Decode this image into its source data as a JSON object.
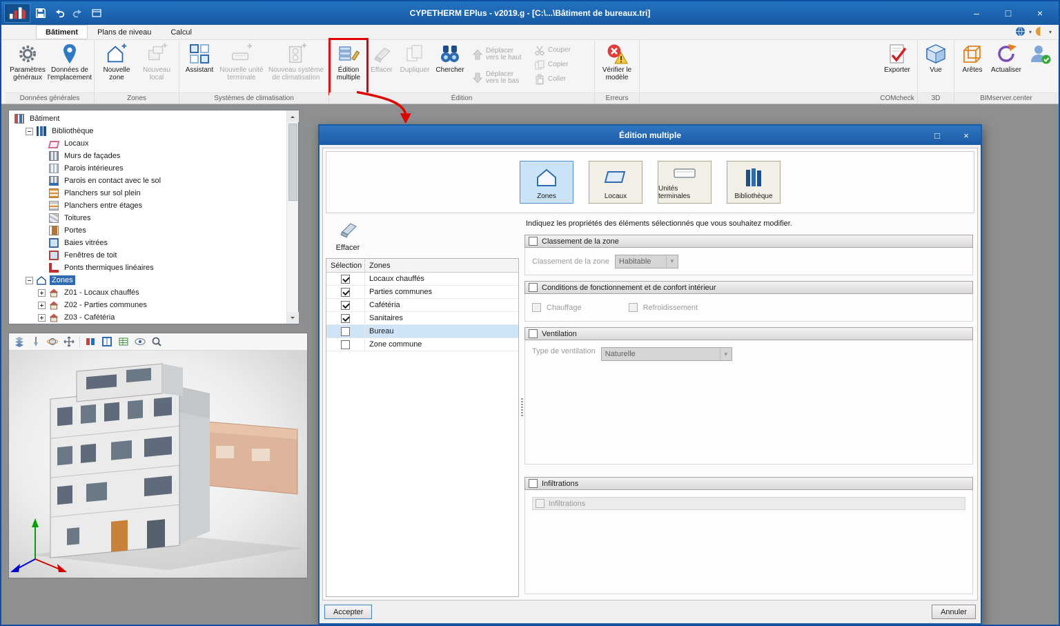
{
  "colors": {
    "titlebar_blue": "#1a5ba6",
    "annotation_red": "#e10000",
    "tree_selection_blue": "#2e6bb4",
    "row_selection_blue": "#cfe4f7"
  },
  "window": {
    "title": "CYPETHERM EPlus - v2019.g - [C:\\...\\Bâtiment de bureaux.tri]",
    "minimize": "–",
    "maximize": "□",
    "close": "×"
  },
  "tabs": [
    {
      "label": "Bâtiment"
    },
    {
      "label": "Plans de niveau"
    },
    {
      "label": "Calcul"
    }
  ],
  "ribbon": {
    "groups": [
      {
        "label": "Données générales",
        "buttons": [
          {
            "label": "Paramètres généraux"
          },
          {
            "label": "Données de l'emplacement"
          }
        ]
      },
      {
        "label": "Zones",
        "buttons": [
          {
            "label": "Nouvelle zone"
          },
          {
            "label": "Nouveau local"
          }
        ]
      },
      {
        "label": "Systèmes de climatisation",
        "buttons": [
          {
            "label": "Assistant"
          },
          {
            "label": "Nouvelle unité terminale"
          },
          {
            "label": "Nouveau système de climatisation"
          }
        ]
      },
      {
        "label": "Édition",
        "buttons": [
          {
            "label": "Édition multiple"
          },
          {
            "label": "Effacer"
          },
          {
            "label": "Dupliquer"
          },
          {
            "label": "Chercher"
          }
        ],
        "stack1": [
          {
            "label": "Déplacer vers le haut"
          },
          {
            "label": "Déplacer vers le bas"
          }
        ],
        "stack2": [
          {
            "label": "Couper"
          },
          {
            "label": "Copier"
          },
          {
            "label": "Coller"
          }
        ]
      },
      {
        "label": "Erreurs",
        "buttons": [
          {
            "label": "Vérifier le modèle"
          }
        ]
      },
      {
        "label": "COMcheck",
        "buttons": [
          {
            "label": "Exporter"
          }
        ]
      },
      {
        "label": "3D",
        "buttons": [
          {
            "label": "Vue"
          }
        ]
      },
      {
        "label": "BIMserver.center",
        "buttons": [
          {
            "label": "Arêtes"
          },
          {
            "label": "Actualiser"
          }
        ]
      }
    ]
  },
  "tree": {
    "items": [
      {
        "label": "Bâtiment"
      },
      {
        "label": "Bibliothèque"
      },
      {
        "label": "Locaux"
      },
      {
        "label": "Murs de façades"
      },
      {
        "label": "Parois intérieures"
      },
      {
        "label": "Parois en contact avec le sol"
      },
      {
        "label": "Planchers sur sol plein"
      },
      {
        "label": "Planchers entre étages"
      },
      {
        "label": "Toitures"
      },
      {
        "label": "Portes"
      },
      {
        "label": "Baies vitrées"
      },
      {
        "label": "Fenêtres de toit"
      },
      {
        "label": "Ponts thermiques linéaires"
      },
      {
        "label": "Zones"
      },
      {
        "label": "Z01 - Locaux chauffés"
      },
      {
        "label": "Z02 - Parties communes"
      },
      {
        "label": "Z03 - Cafétéria"
      }
    ]
  },
  "dialog": {
    "title": "Édition multiple",
    "maximize": "□",
    "close": "×",
    "categories": [
      {
        "label": "Zones"
      },
      {
        "label": "Locaux"
      },
      {
        "label": "Unités terminales"
      },
      {
        "label": "Bibliothèque"
      }
    ],
    "erase_label": "Effacer",
    "table": {
      "headers": [
        "Sélection",
        "Zones"
      ],
      "rows": [
        {
          "label": "Locaux chauffés",
          "checked": true
        },
        {
          "label": "Parties communes",
          "checked": true
        },
        {
          "label": "Cafétéria",
          "checked": true
        },
        {
          "label": "Sanitaires",
          "checked": true
        },
        {
          "label": "Bureau",
          "checked": false
        },
        {
          "label": "Zone commune",
          "checked": false
        }
      ]
    },
    "instruction": "Indiquez les propriétés des éléments sélectionnés que vous souhaitez modifier.",
    "sections": [
      {
        "header": "Classement de la zone",
        "field_label": "Classement de la zone",
        "value": "Habitable"
      },
      {
        "header": "Conditions de fonctionnement et de confort intérieur",
        "check1": "Chauffage",
        "check2": "Refroidissement"
      },
      {
        "header": "Ventilation",
        "field_label": "Type de ventilation",
        "value": "Naturelle"
      },
      {
        "header": "Infiltrations",
        "check1": "Infiltrations"
      }
    ],
    "accept_label": "Accepter",
    "cancel_label": "Annuler"
  }
}
